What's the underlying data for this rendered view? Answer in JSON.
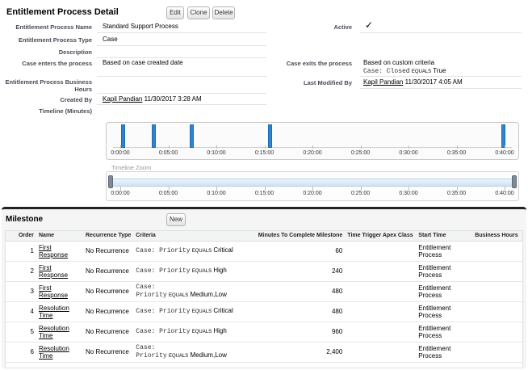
{
  "detail": {
    "title": "Entitlement Process Detail",
    "buttons": {
      "edit": "Edit",
      "clone": "Clone",
      "delete": "Delete"
    },
    "fields": {
      "name_label": "Entitlement Process Name",
      "name_value": "Standard Support Process",
      "active_label": "Active",
      "active_value": "✓",
      "type_label": "Entitlement Process Type",
      "type_value": "Case",
      "description_label": "Description",
      "enters_label": "Case enters the process",
      "enters_value": "Based on case created date",
      "exits_label": "Case exits the process",
      "exits_value": "Based on custom criteria",
      "exits_criteria_field": "Case: Closed",
      "exits_criteria_op": "EQUALS",
      "exits_criteria_value": "True",
      "hours_label_1": "Entitlement Process Business",
      "hours_label_2": "Hours",
      "modified_label": "Last Modified By",
      "modified_user": "Kapil Pandian",
      "modified_date": "11/30/2017 4:05 AM",
      "created_label": "Created By",
      "created_user": "Kapil Pandian",
      "created_date": "11/30/2017 3:28 AM",
      "timeline_label": "Timeline (Minutes)"
    }
  },
  "timeline": {
    "tick_labels": [
      "0:00:00",
      "0:05:00",
      "0:10:00",
      "0:15:00",
      "0:20:00",
      "0:25:00",
      "0:30:00",
      "0:35:00",
      "0:40:00"
    ],
    "zoom_label": "Timeline Zoom",
    "bar_color": "#2f84d1"
  },
  "milestone": {
    "title": "Milestone",
    "new_button": "New",
    "columns": [
      "Order",
      "Name",
      "Recurrence Type",
      "Criteria",
      "Minutes To Complete Milestone",
      "Time Trigger Apex Class",
      "Start Time",
      "Business Hours"
    ],
    "rows": [
      {
        "order": "1",
        "name1": "First Response",
        "name2": "",
        "recurrence": "No Recurrence",
        "crit1": "Case: Priority",
        "crit_op": "EQUALS",
        "crit_val": "Critical",
        "crit_split": false,
        "minutes": "60",
        "start1": "Entitlement",
        "start2": "Process"
      },
      {
        "order": "2",
        "name1": "First Response",
        "name2": "",
        "recurrence": "No Recurrence",
        "crit1": "Case: Priority",
        "crit_op": "EQUALS",
        "crit_val": "High",
        "crit_split": false,
        "minutes": "240",
        "start1": "Entitlement",
        "start2": "Process"
      },
      {
        "order": "3",
        "name1": "First Response",
        "name2": "",
        "recurrence": "No Recurrence",
        "crit1": "Case:",
        "crit2": "Priority",
        "crit_op": "EQUALS",
        "crit_val": "Medium,Low",
        "crit_split": true,
        "minutes": "480",
        "start1": "Entitlement",
        "start2": "Process"
      },
      {
        "order": "4",
        "name1": "Resolution",
        "name2": "Time",
        "recurrence": "No Recurrence",
        "crit1": "Case: Priority",
        "crit_op": "EQUALS",
        "crit_val": "Critical",
        "crit_split": false,
        "minutes": "480",
        "start1": "Entitlement",
        "start2": "Process"
      },
      {
        "order": "5",
        "name1": "Resolution",
        "name2": "Time",
        "recurrence": "No Recurrence",
        "crit1": "Case: Priority",
        "crit_op": "EQUALS",
        "crit_val": "High",
        "crit_split": false,
        "minutes": "960",
        "start1": "Entitlement",
        "start2": "Process"
      },
      {
        "order": "6",
        "name1": "Resolution",
        "name2": "Time",
        "recurrence": "No Recurrence",
        "crit1": "Case:",
        "crit2": "Priority",
        "crit_op": "EQUALS",
        "crit_val": "Medium,Low",
        "crit_split": true,
        "minutes": "2,400",
        "start1": "Entitlement",
        "start2": "Process"
      }
    ]
  }
}
